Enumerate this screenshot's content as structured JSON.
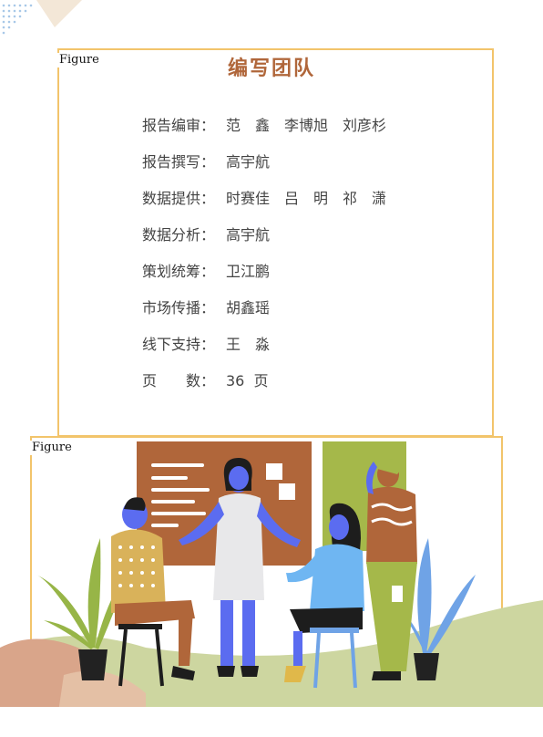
{
  "figure_label": "Figure",
  "title": "编写团队",
  "credits": [
    {
      "label": "报告编审：",
      "value": "范　鑫　李博旭　刘彦杉"
    },
    {
      "label": "报告撰写：",
      "value": "高宇航"
    },
    {
      "label": "数据提供：",
      "value": "时赛佳　吕　明　祁　潇"
    },
    {
      "label": "数据分析：",
      "value": "高宇航"
    },
    {
      "label": "策划统筹：",
      "value": "卫江鹏"
    },
    {
      "label": "市场传播：",
      "value": "胡鑫瑶"
    },
    {
      "label": "线下支持：",
      "value": "王　淼"
    },
    {
      "label": "页　　数：",
      "value": "36  页"
    }
  ],
  "colors": {
    "title": "#b0663a",
    "box_border": "#f2c46b",
    "board_brown": "#b0663a",
    "board_green": "#a5b84a",
    "skin_blue": "#5b6cf0",
    "ground": "#c9d39a"
  },
  "illustration": "team-meeting-illustration"
}
